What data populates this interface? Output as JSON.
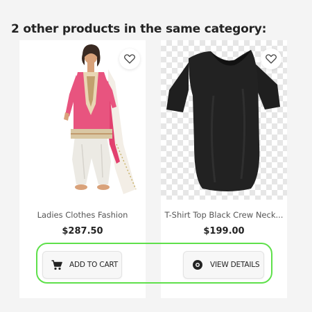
{
  "section": {
    "title": "2 other products in the same category:"
  },
  "products": [
    {
      "name": "Ladies Clothes Fashion",
      "price": "$287.50",
      "button_label": "ADD TO CART",
      "button_icon": "cart-icon",
      "image": "pink-salwar-kameez-model"
    },
    {
      "name": "T-Shirt Top Black Crew Neck...",
      "price": "$199.00",
      "button_label": "VIEW DETAILS",
      "button_icon": "eye-icon",
      "image": "black-crew-neck-tshirt"
    }
  ],
  "colors": {
    "highlight": "#5ee04a",
    "background": "#f4f4f4",
    "text": "#232323"
  }
}
